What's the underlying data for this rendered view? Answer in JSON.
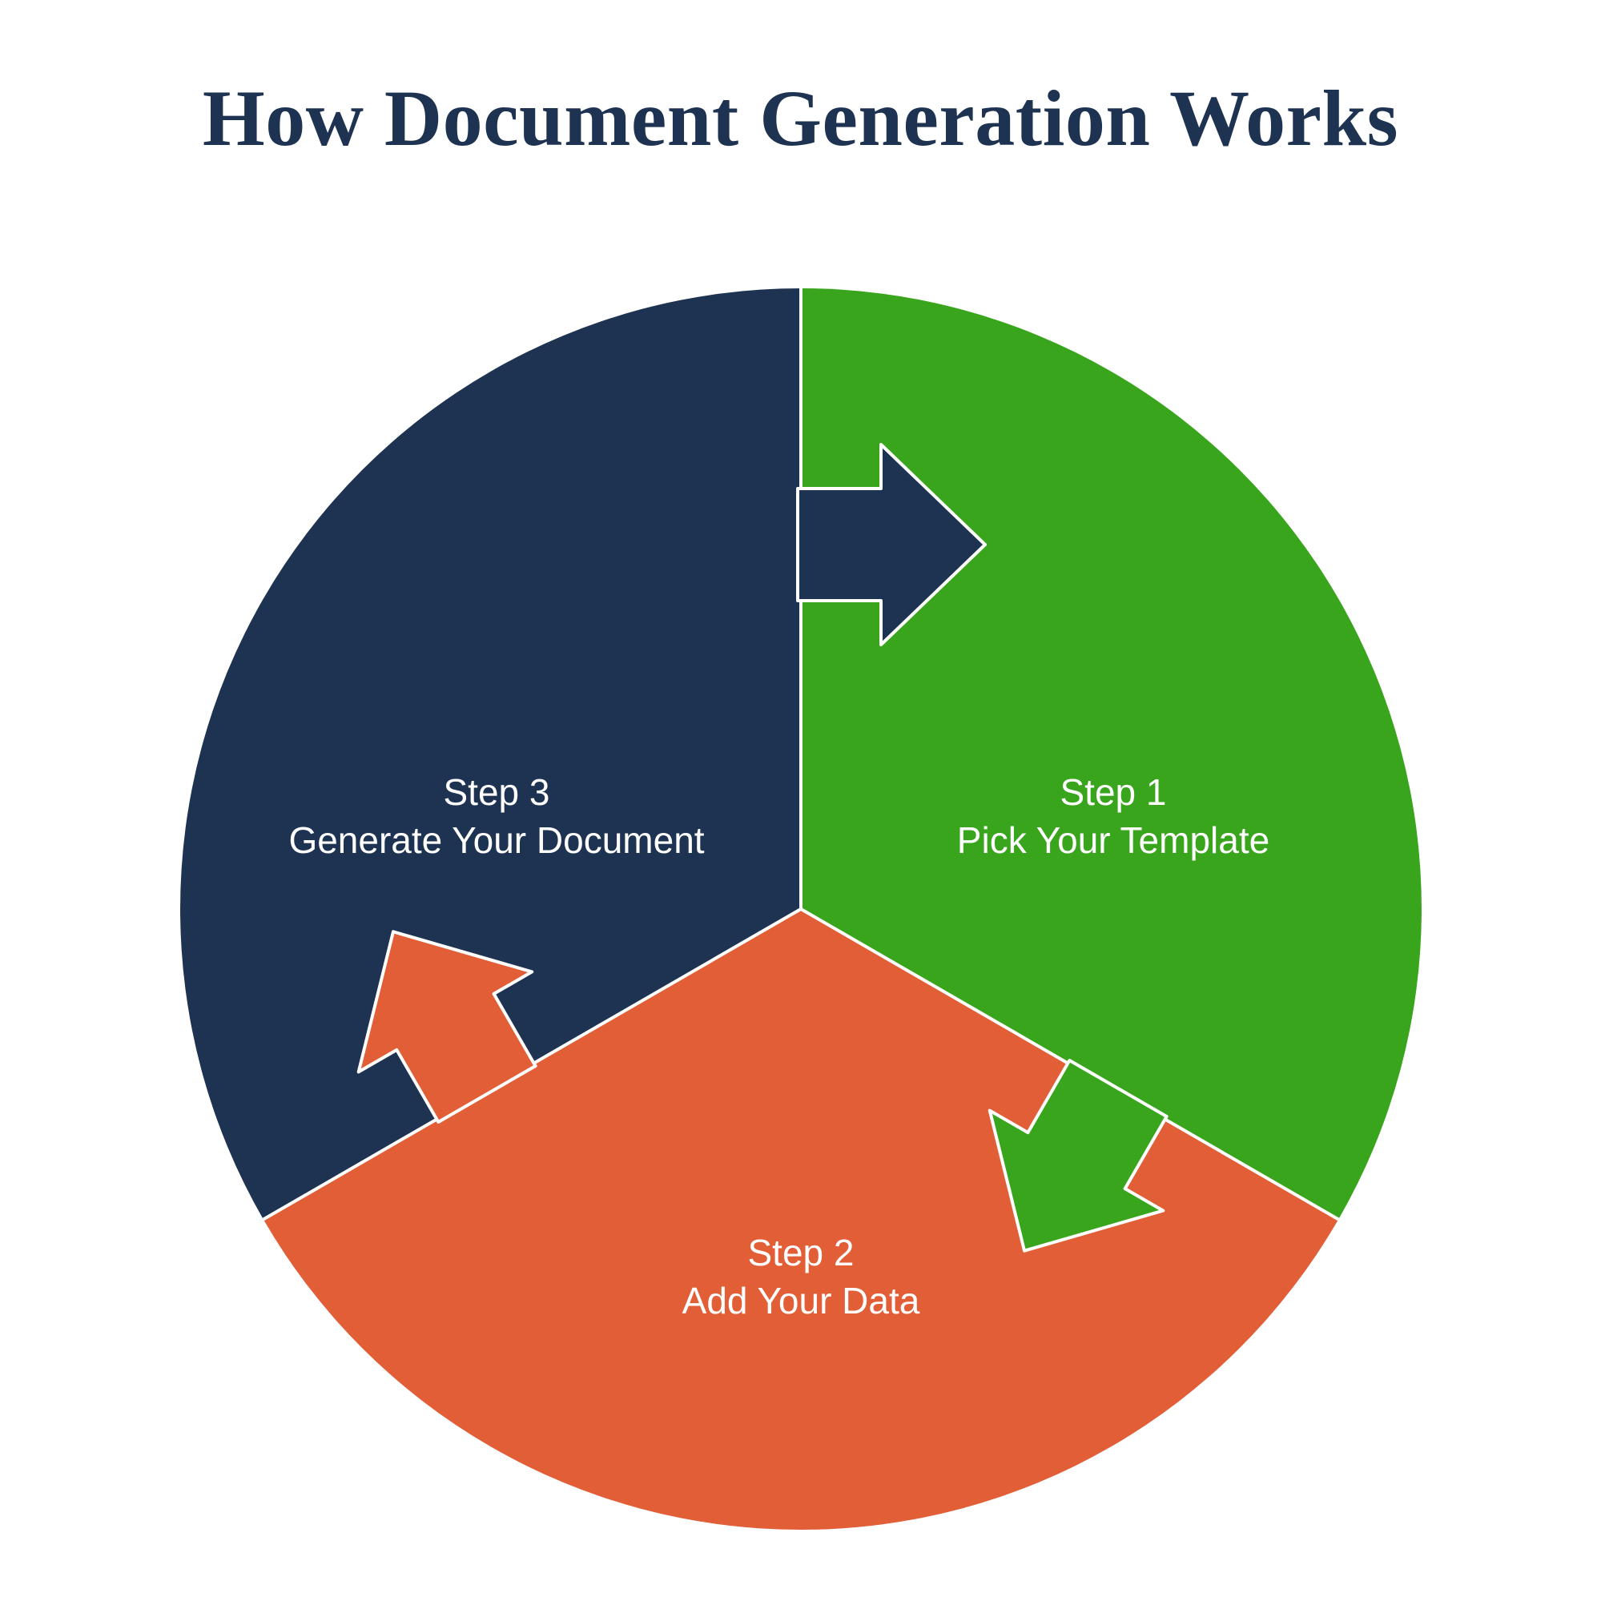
{
  "title": "How Document Generation Works",
  "colors": {
    "navy": "#1e3352",
    "green": "#39a51d",
    "orange": "#e15e36",
    "white": "#ffffff"
  },
  "segments": {
    "step1": {
      "line1": "Step 1",
      "line2": "Pick Your Template"
    },
    "step2": {
      "line1": "Step 2",
      "line2": "Add Your Data"
    },
    "step3": {
      "line1": "Step 3",
      "line2": "Generate Your Document"
    }
  }
}
